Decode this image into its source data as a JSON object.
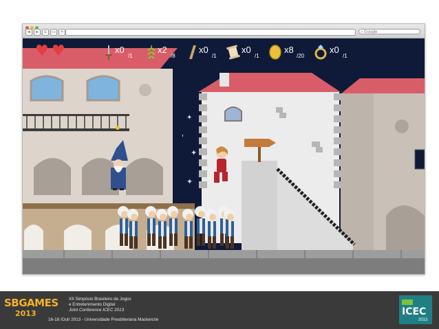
{
  "browser": {
    "search_placeholder": "Google",
    "nav_back": "◂",
    "nav_forward": "▸",
    "nav_reload": "c",
    "nav_add": "+"
  },
  "hud": {
    "lives": 2,
    "items": [
      {
        "icon": "sword-icon",
        "count": "x0",
        "total": "/1"
      },
      {
        "icon": "herb-icon",
        "count": "x2",
        "total": "/8"
      },
      {
        "icon": "plank-icon",
        "count": "x0",
        "total": "/1"
      },
      {
        "icon": "scroll-icon",
        "count": "x0",
        "total": "/1"
      },
      {
        "icon": "coin-icon",
        "count": "x8",
        "total": "/20"
      },
      {
        "icon": "ring-icon",
        "count": "x0",
        "total": "/1"
      }
    ]
  },
  "footer": {
    "logo_text": "SBGAMES",
    "logo_year": "2013",
    "line1": "XII Simpósio Brasileiro de Jogos",
    "line2": "e Entretenimento Digital",
    "line3": "Joint Conference ICEC 2013",
    "line4": "16-18 /Out/ 2013 - Universidade Presbiteriana Mackenzie",
    "icec_logo": "ICEC",
    "icec_year": "2013"
  },
  "colors": {
    "sky": "#0f1a38",
    "roof": "#d95d68",
    "wall_beige": "#ddd5cc",
    "ground": "#8e8e8e",
    "footer_bg": "#3a3a3a",
    "soldier_coat": "#2f5f97",
    "player_red": "#b8232d"
  }
}
